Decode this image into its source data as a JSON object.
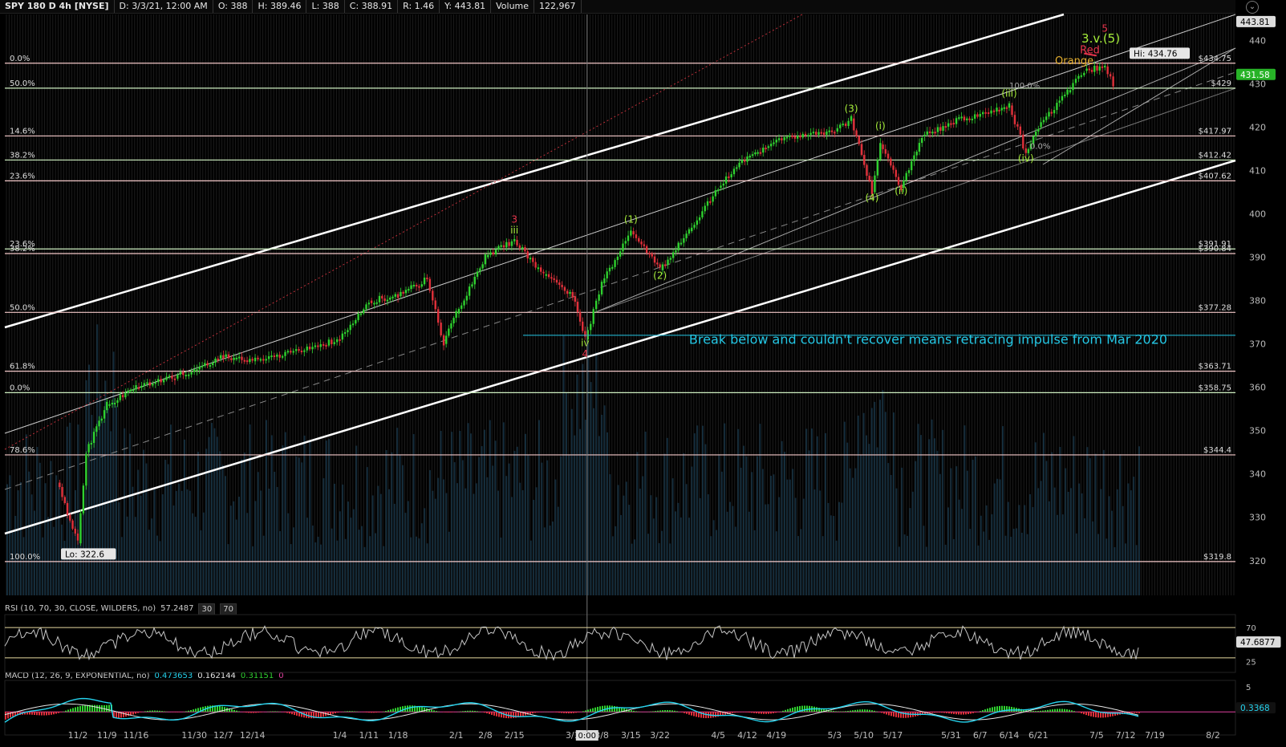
{
  "header": {
    "symbol": "SPY 180 D 4h [NYSE]",
    "date": "D: 3/3/21, 12:00 AM",
    "open": "O: 388",
    "high": "H: 389.46",
    "low": "L: 388",
    "close": "C: 388.91",
    "range": "R: 1.46",
    "y": "Y: 443.81",
    "volume_label": "Volume",
    "volume_value": "122,967"
  },
  "colors": {
    "up": "#2fd12f",
    "down": "#e0303a",
    "bg": "#000000",
    "grid": "#2a2a2a",
    "fib_green": "#cdeec0",
    "fib_pink": "#f2c7c7",
    "channel": "#ffffff",
    "annotation_cyan": "#24c8e6",
    "wave_green": "#a6ee3a",
    "wave_red": "#e8344c",
    "price_badge": "#27b327",
    "rsi": "#c4c4c4",
    "macd": "#25d3ee"
  },
  "chart_data": [
    {
      "type": "candlestick",
      "title": "SPY 180 D 4h [NYSE]",
      "x_ticks": [
        "11/2",
        "11/9",
        "11/16",
        "11/30",
        "12/7",
        "12/14",
        "1/4",
        "1/11",
        "1/18",
        "2/1",
        "2/8",
        "2/15",
        "3/1",
        "3/8",
        "3/15",
        "3/22",
        "4/5",
        "4/12",
        "4/19",
        "5/3",
        "5/10",
        "5/17",
        "5/31",
        "6/7",
        "6/14",
        "6/21",
        "7/5",
        "7/12",
        "7/19",
        "8/2"
      ],
      "y_ticks": [
        320,
        330,
        340,
        350,
        360,
        370,
        380,
        390,
        400,
        410,
        420,
        430,
        440
      ],
      "ylim": [
        312,
        446
      ],
      "key_points": [
        {
          "x": "10/28",
          "y": 338
        },
        {
          "x": "11/2",
          "y": 324
        },
        {
          "x": "11/4",
          "y": 345
        },
        {
          "x": "11/9",
          "y": 356
        },
        {
          "x": "11/16",
          "y": 360
        },
        {
          "x": "11/30",
          "y": 364
        },
        {
          "x": "12/7",
          "y": 367
        },
        {
          "x": "12/14",
          "y": 366
        },
        {
          "x": "1/4",
          "y": 371
        },
        {
          "x": "1/11",
          "y": 380
        },
        {
          "x": "1/18",
          "y": 381
        },
        {
          "x": "1/25",
          "y": 385
        },
        {
          "x": "1/29",
          "y": 370
        },
        {
          "x": "2/1",
          "y": 377
        },
        {
          "x": "2/8",
          "y": 390
        },
        {
          "x": "2/15",
          "y": 394
        },
        {
          "x": "2/22",
          "y": 386
        },
        {
          "x": "3/1",
          "y": 381
        },
        {
          "x": "3/4",
          "y": 371
        },
        {
          "x": "3/8",
          "y": 384
        },
        {
          "x": "3/15",
          "y": 396
        },
        {
          "x": "3/22",
          "y": 387
        },
        {
          "x": "3/29",
          "y": 396
        },
        {
          "x": "4/5",
          "y": 406
        },
        {
          "x": "4/12",
          "y": 413
        },
        {
          "x": "4/19",
          "y": 417
        },
        {
          "x": "4/26",
          "y": 418
        },
        {
          "x": "5/3",
          "y": 419
        },
        {
          "x": "5/7",
          "y": 422
        },
        {
          "x": "5/12",
          "y": 405
        },
        {
          "x": "5/14",
          "y": 416
        },
        {
          "x": "5/19",
          "y": 406
        },
        {
          "x": "5/24",
          "y": 418
        },
        {
          "x": "5/31",
          "y": 421
        },
        {
          "x": "6/7",
          "y": 423
        },
        {
          "x": "6/11",
          "y": 424
        },
        {
          "x": "6/14",
          "y": 425
        },
        {
          "x": "6/18",
          "y": 414
        },
        {
          "x": "6/21",
          "y": 420
        },
        {
          "x": "6/28",
          "y": 428
        },
        {
          "x": "7/2",
          "y": 433
        },
        {
          "x": "7/7",
          "y": 434
        },
        {
          "x": "7/9",
          "y": 430
        }
      ],
      "hi_label": "Hi: 434.76",
      "lo_label": "Lo: 322.6",
      "current_price": "431.58",
      "top_price": "443.81",
      "fib_levels": [
        {
          "pct": "0.0%",
          "price": "$434.75",
          "value": 434.75,
          "color": "pink"
        },
        {
          "pct": "50.0%",
          "price": "$429",
          "value": 429,
          "color": "green"
        },
        {
          "pct": "14.6%",
          "price": "$417.97",
          "value": 417.97,
          "color": "pink"
        },
        {
          "pct": "38.2%",
          "price": "$412.42",
          "value": 412.42,
          "color": "green"
        },
        {
          "pct": "23.6%",
          "price": "$407.62",
          "value": 407.62,
          "color": "pink"
        },
        {
          "pct": "23.6%",
          "price": "$391.91",
          "value": 391.91,
          "color": "green"
        },
        {
          "pct": "38.2%",
          "price": "$390.84",
          "value": 390.84,
          "color": "pink"
        },
        {
          "pct": "50.0%",
          "price": "$377.28",
          "value": 377.28,
          "color": "pink"
        },
        {
          "pct": "61.8%",
          "price": "$363.71",
          "value": 363.71,
          "color": "pink"
        },
        {
          "pct": "0.0%",
          "price": "$358.75",
          "value": 358.75,
          "color": "green"
        },
        {
          "pct": "78.6%",
          "price": "$344.4",
          "value": 344.4,
          "color": "pink"
        },
        {
          "pct": "100.0%",
          "price": "$319.8",
          "value": 319.8,
          "color": "pink"
        }
      ],
      "wave_labels": [
        {
          "text": "3",
          "x": "2/15",
          "y": 398,
          "color": "red"
        },
        {
          "text": "iii",
          "x": "2/15",
          "y": 395.5,
          "color": "green"
        },
        {
          "text": "iv",
          "x": "3/4",
          "y": 369.5,
          "color": "green"
        },
        {
          "text": "4",
          "x": "3/4",
          "y": 367,
          "color": "red"
        },
        {
          "text": "(1)",
          "x": "3/15",
          "y": 398,
          "color": "green"
        },
        {
          "text": "(2)",
          "x": "3/22",
          "y": 385,
          "color": "green"
        },
        {
          "text": "(3)",
          "x": "5/7",
          "y": 423.5,
          "color": "green"
        },
        {
          "text": "(4)",
          "x": "5/12",
          "y": 403,
          "color": "green"
        },
        {
          "text": "(i)",
          "x": "5/14",
          "y": 419.5,
          "color": "green"
        },
        {
          "text": "(ii)",
          "x": "5/19",
          "y": 404.5,
          "color": "green"
        },
        {
          "text": "(iii)",
          "x": "6/14",
          "y": 427,
          "color": "green"
        },
        {
          "text": "(iv)",
          "x": "6/18",
          "y": 412,
          "color": "green"
        },
        {
          "text": "3.v.(5)",
          "x": "7/6",
          "y": 439.5,
          "color": "green"
        },
        {
          "text": "5",
          "x": "7/7",
          "y": 442,
          "color": "red"
        }
      ],
      "annotations": [
        {
          "text": "Break below and couldn't recover means retracing impulse from Mar 2020",
          "x": "3/29",
          "y": 370,
          "color": "cyan"
        },
        {
          "text": "Red",
          "x": "7/1",
          "y": 437,
          "color": "red"
        },
        {
          "text": "Orange",
          "x": "6/25",
          "y": 434.5,
          "color": "orange"
        },
        {
          "text": "100.0%",
          "x": "6/14",
          "y": 429,
          "color": "gray"
        },
        {
          "text": "0.0%",
          "x": "6/19",
          "y": 415,
          "color": "gray"
        }
      ]
    },
    {
      "type": "line",
      "title": "RSI (10, 70, 30, CLOSE, WILDERS, no)",
      "value": "57.2487",
      "levels": [
        "30",
        "70"
      ],
      "current": "47.6877",
      "y_ticks": [
        25,
        70
      ],
      "ylim": [
        15,
        85
      ]
    },
    {
      "type": "line",
      "title": "MACD (12, 26, 9, EXPONENTIAL, no)",
      "values": [
        "0.473653",
        "0.162144",
        "0.31151",
        "0"
      ],
      "current": "0.3368",
      "y_ticks": [
        5
      ],
      "ylim": [
        -4,
        6
      ]
    }
  ],
  "cursor": {
    "time": "0:00",
    "x_tick": "3/1"
  }
}
